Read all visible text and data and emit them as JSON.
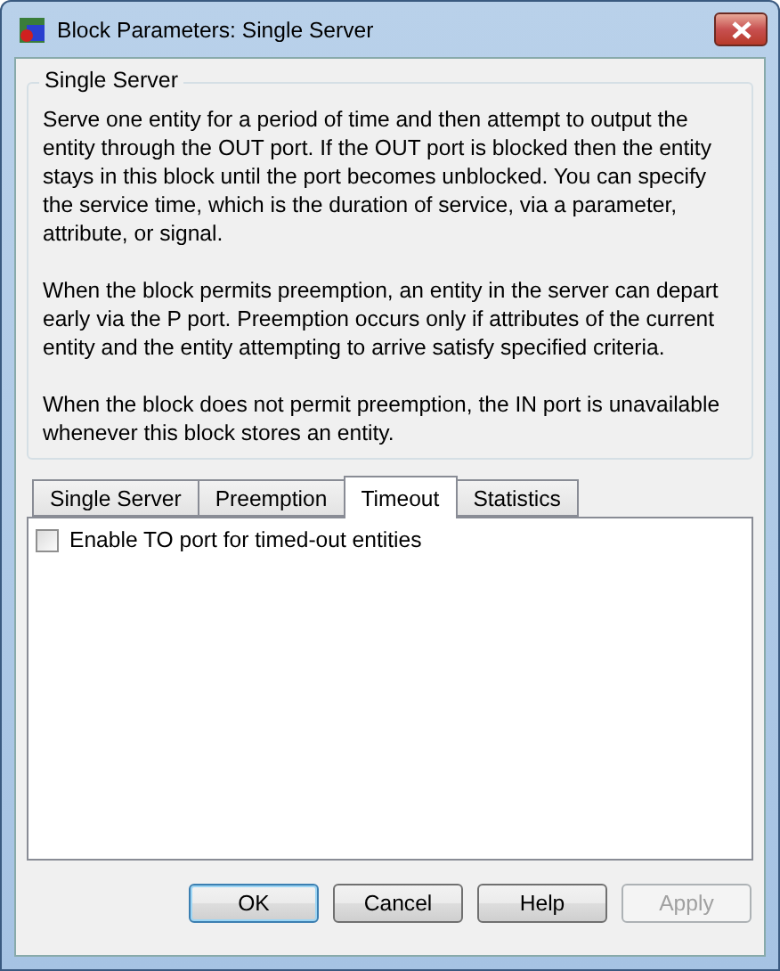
{
  "window": {
    "title": "Block Parameters: Single Server"
  },
  "description": {
    "legend": "Single Server",
    "paragraphs": [
      "Serve one entity for a period of time and then attempt to output the entity through the OUT port. If the OUT port is blocked then the entity stays in this block until the port becomes unblocked. You can specify the service time, which is the duration of service, via a parameter, attribute, or signal.",
      "When the block permits preemption, an entity in the server can depart early via the P port. Preemption occurs only if attributes of the current entity and the entity attempting to arrive satisfy specified criteria.",
      "When the block does not permit preemption, the IN port is unavailable whenever this block stores an entity."
    ]
  },
  "tabs": [
    {
      "label": "Single Server",
      "selected": false
    },
    {
      "label": "Preemption",
      "selected": false
    },
    {
      "label": "Timeout",
      "selected": true
    },
    {
      "label": "Statistics",
      "selected": false
    }
  ],
  "options": [
    {
      "label": "Enable TO port for timed-out entities",
      "checked": false
    }
  ],
  "buttons": [
    {
      "label": "OK",
      "disabled": false,
      "default": true
    },
    {
      "label": "Cancel",
      "disabled": false,
      "default": false
    },
    {
      "label": "Help",
      "disabled": false,
      "default": false
    },
    {
      "label": "Apply",
      "disabled": true,
      "default": false
    }
  ]
}
